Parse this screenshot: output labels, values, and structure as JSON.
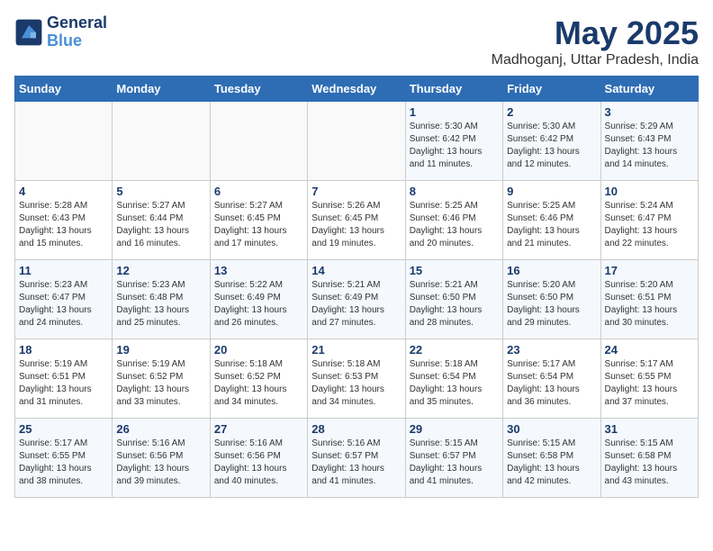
{
  "logo": {
    "line1": "General",
    "line2": "Blue"
  },
  "title": "May 2025",
  "subtitle": "Madhoganj, Uttar Pradesh, India",
  "weekdays": [
    "Sunday",
    "Monday",
    "Tuesday",
    "Wednesday",
    "Thursday",
    "Friday",
    "Saturday"
  ],
  "weeks": [
    [
      {
        "day": "",
        "info": ""
      },
      {
        "day": "",
        "info": ""
      },
      {
        "day": "",
        "info": ""
      },
      {
        "day": "",
        "info": ""
      },
      {
        "day": "1",
        "info": "Sunrise: 5:30 AM\nSunset: 6:42 PM\nDaylight: 13 hours\nand 11 minutes."
      },
      {
        "day": "2",
        "info": "Sunrise: 5:30 AM\nSunset: 6:42 PM\nDaylight: 13 hours\nand 12 minutes."
      },
      {
        "day": "3",
        "info": "Sunrise: 5:29 AM\nSunset: 6:43 PM\nDaylight: 13 hours\nand 14 minutes."
      }
    ],
    [
      {
        "day": "4",
        "info": "Sunrise: 5:28 AM\nSunset: 6:43 PM\nDaylight: 13 hours\nand 15 minutes."
      },
      {
        "day": "5",
        "info": "Sunrise: 5:27 AM\nSunset: 6:44 PM\nDaylight: 13 hours\nand 16 minutes."
      },
      {
        "day": "6",
        "info": "Sunrise: 5:27 AM\nSunset: 6:45 PM\nDaylight: 13 hours\nand 17 minutes."
      },
      {
        "day": "7",
        "info": "Sunrise: 5:26 AM\nSunset: 6:45 PM\nDaylight: 13 hours\nand 19 minutes."
      },
      {
        "day": "8",
        "info": "Sunrise: 5:25 AM\nSunset: 6:46 PM\nDaylight: 13 hours\nand 20 minutes."
      },
      {
        "day": "9",
        "info": "Sunrise: 5:25 AM\nSunset: 6:46 PM\nDaylight: 13 hours\nand 21 minutes."
      },
      {
        "day": "10",
        "info": "Sunrise: 5:24 AM\nSunset: 6:47 PM\nDaylight: 13 hours\nand 22 minutes."
      }
    ],
    [
      {
        "day": "11",
        "info": "Sunrise: 5:23 AM\nSunset: 6:47 PM\nDaylight: 13 hours\nand 24 minutes."
      },
      {
        "day": "12",
        "info": "Sunrise: 5:23 AM\nSunset: 6:48 PM\nDaylight: 13 hours\nand 25 minutes."
      },
      {
        "day": "13",
        "info": "Sunrise: 5:22 AM\nSunset: 6:49 PM\nDaylight: 13 hours\nand 26 minutes."
      },
      {
        "day": "14",
        "info": "Sunrise: 5:21 AM\nSunset: 6:49 PM\nDaylight: 13 hours\nand 27 minutes."
      },
      {
        "day": "15",
        "info": "Sunrise: 5:21 AM\nSunset: 6:50 PM\nDaylight: 13 hours\nand 28 minutes."
      },
      {
        "day": "16",
        "info": "Sunrise: 5:20 AM\nSunset: 6:50 PM\nDaylight: 13 hours\nand 29 minutes."
      },
      {
        "day": "17",
        "info": "Sunrise: 5:20 AM\nSunset: 6:51 PM\nDaylight: 13 hours\nand 30 minutes."
      }
    ],
    [
      {
        "day": "18",
        "info": "Sunrise: 5:19 AM\nSunset: 6:51 PM\nDaylight: 13 hours\nand 31 minutes."
      },
      {
        "day": "19",
        "info": "Sunrise: 5:19 AM\nSunset: 6:52 PM\nDaylight: 13 hours\nand 33 minutes."
      },
      {
        "day": "20",
        "info": "Sunrise: 5:18 AM\nSunset: 6:52 PM\nDaylight: 13 hours\nand 34 minutes."
      },
      {
        "day": "21",
        "info": "Sunrise: 5:18 AM\nSunset: 6:53 PM\nDaylight: 13 hours\nand 34 minutes."
      },
      {
        "day": "22",
        "info": "Sunrise: 5:18 AM\nSunset: 6:54 PM\nDaylight: 13 hours\nand 35 minutes."
      },
      {
        "day": "23",
        "info": "Sunrise: 5:17 AM\nSunset: 6:54 PM\nDaylight: 13 hours\nand 36 minutes."
      },
      {
        "day": "24",
        "info": "Sunrise: 5:17 AM\nSunset: 6:55 PM\nDaylight: 13 hours\nand 37 minutes."
      }
    ],
    [
      {
        "day": "25",
        "info": "Sunrise: 5:17 AM\nSunset: 6:55 PM\nDaylight: 13 hours\nand 38 minutes."
      },
      {
        "day": "26",
        "info": "Sunrise: 5:16 AM\nSunset: 6:56 PM\nDaylight: 13 hours\nand 39 minutes."
      },
      {
        "day": "27",
        "info": "Sunrise: 5:16 AM\nSunset: 6:56 PM\nDaylight: 13 hours\nand 40 minutes."
      },
      {
        "day": "28",
        "info": "Sunrise: 5:16 AM\nSunset: 6:57 PM\nDaylight: 13 hours\nand 41 minutes."
      },
      {
        "day": "29",
        "info": "Sunrise: 5:15 AM\nSunset: 6:57 PM\nDaylight: 13 hours\nand 41 minutes."
      },
      {
        "day": "30",
        "info": "Sunrise: 5:15 AM\nSunset: 6:58 PM\nDaylight: 13 hours\nand 42 minutes."
      },
      {
        "day": "31",
        "info": "Sunrise: 5:15 AM\nSunset: 6:58 PM\nDaylight: 13 hours\nand 43 minutes."
      }
    ]
  ]
}
